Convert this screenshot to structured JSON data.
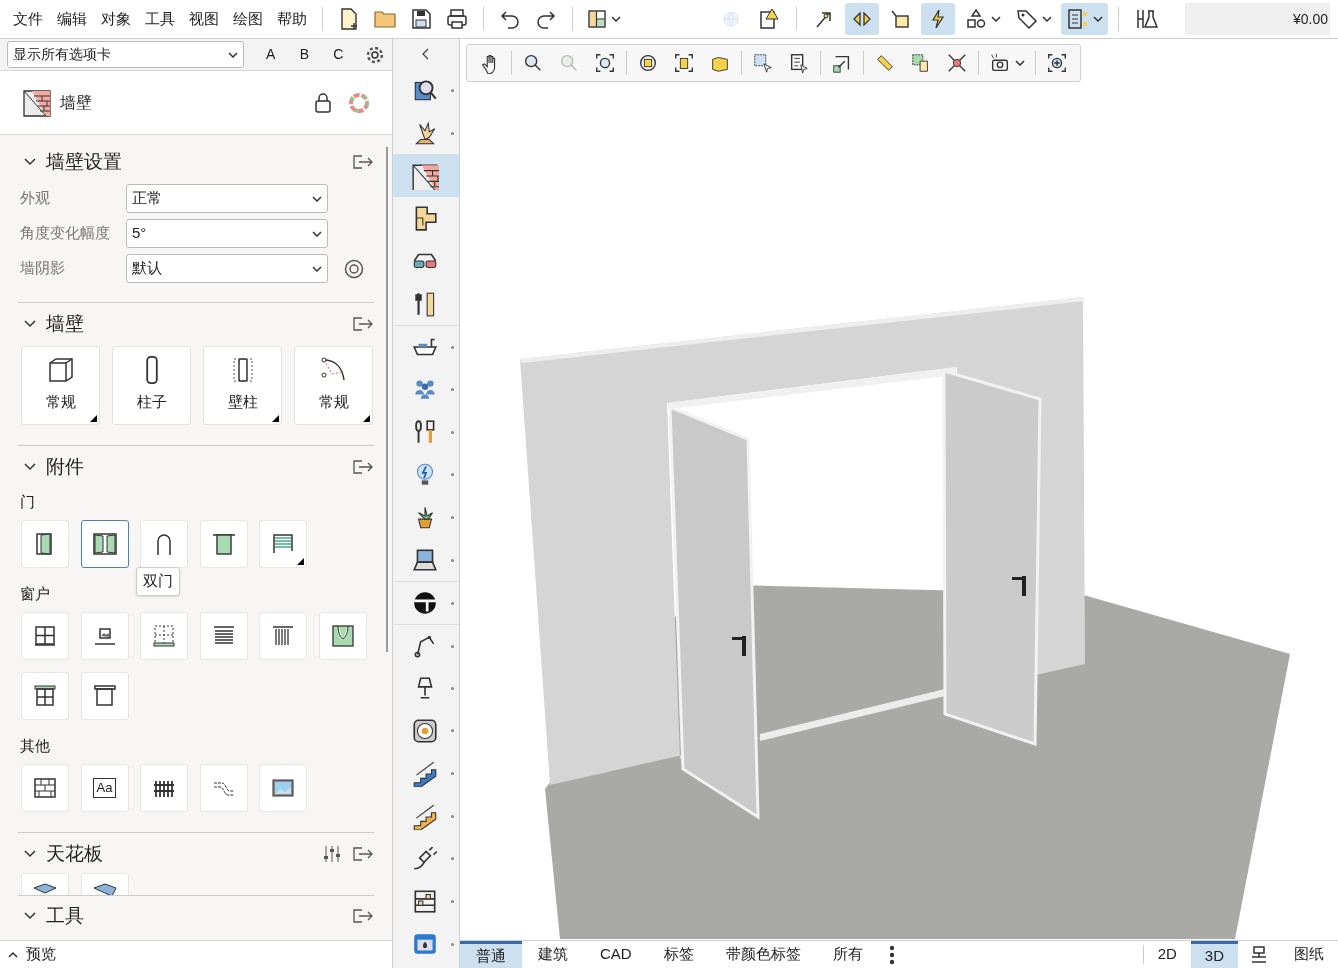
{
  "menu": [
    "文件",
    "编辑",
    "对象",
    "工具",
    "视图",
    "绘图",
    "帮助"
  ],
  "toggles": [
    {
      "selected": false,
      "disabled": true
    },
    {
      "selected": false,
      "disabled": false
    },
    {
      "selected": false,
      "disabled": false
    },
    {
      "selected": true,
      "disabled": false
    },
    {
      "selected": false,
      "disabled": false
    },
    {
      "selected": true,
      "disabled": false
    },
    {
      "selected": false,
      "disabled": false
    },
    {
      "selected": false,
      "disabled": false
    },
    {
      "selected": true,
      "disabled": false
    },
    {
      "selected": false,
      "disabled": false
    }
  ],
  "price": "¥0.00",
  "tab_filter": {
    "value": "显示所有选项卡"
  },
  "letters": [
    "A",
    "B",
    "C"
  ],
  "panel": {
    "title": "墙壁"
  },
  "wall_settings": {
    "title": "墙壁设置",
    "fields": [
      {
        "label": "外观",
        "value": "正常"
      },
      {
        "label": "角度变化幅度",
        "value": "5°"
      },
      {
        "label": "墙阴影",
        "value": "默认"
      }
    ]
  },
  "walls": {
    "title": "墙壁",
    "tools": [
      {
        "label": "常规",
        "more": true
      },
      {
        "label": "柱子",
        "more": false
      },
      {
        "label": "壁柱",
        "more": true
      },
      {
        "label": "常规",
        "more": true
      }
    ]
  },
  "accessories": {
    "title": "附件",
    "groups": [
      {
        "title": "门",
        "items": [
          {
            "selected": false,
            "more": false
          },
          {
            "selected": true,
            "more": false
          },
          {
            "selected": false,
            "more": false
          },
          {
            "selected": false,
            "more": false
          },
          {
            "selected": false,
            "more": true
          }
        ]
      },
      {
        "title": "窗户",
        "items": [
          {
            "selected": false,
            "more": false
          },
          {
            "selected": false,
            "more": false
          },
          {
            "selected": false,
            "more": false
          },
          {
            "selected": false,
            "more": false
          },
          {
            "selected": false,
            "more": false
          },
          {
            "selected": false,
            "more": false
          },
          {
            "selected": false,
            "more": false
          },
          {
            "selected": false,
            "more": false
          }
        ]
      },
      {
        "title": "其他",
        "items": [
          {
            "selected": false,
            "more": false
          },
          {
            "selected": false,
            "more": false,
            "label": "Aa"
          },
          {
            "selected": false,
            "more": false
          },
          {
            "selected": false,
            "more": false
          },
          {
            "selected": false,
            "more": false
          }
        ]
      }
    ]
  },
  "tooltip": "双门",
  "ceiling": {
    "title": "天花板"
  },
  "tools_section": {
    "title": "工具"
  },
  "preview": {
    "label": "预览"
  },
  "categories": [
    {
      "selected": false,
      "more": true
    },
    {
      "selected": false,
      "more": true
    },
    {
      "selected": true,
      "more": false
    },
    {
      "selected": false,
      "more": false
    },
    {
      "selected": false,
      "more": false
    },
    {
      "selected": false,
      "more": false
    },
    {
      "selected": false,
      "more": true
    },
    {
      "selected": false,
      "more": true
    },
    {
      "selected": false,
      "more": true
    },
    {
      "selected": false,
      "more": true
    },
    {
      "selected": false,
      "more": true
    },
    {
      "selected": false,
      "more": true
    },
    {
      "selected": false,
      "more": true
    },
    {
      "selected": false,
      "more": true
    },
    {
      "selected": false,
      "more": true
    },
    {
      "selected": false,
      "more": true
    },
    {
      "selected": false,
      "more": true
    },
    {
      "selected": false,
      "more": true
    },
    {
      "selected": false,
      "more": true
    },
    {
      "selected": false,
      "more": true
    },
    {
      "selected": false,
      "more": true
    }
  ],
  "bottom_tabs": [
    {
      "label": "普通",
      "selected": true
    },
    {
      "label": "建筑",
      "selected": false
    },
    {
      "label": "CAD",
      "selected": false
    },
    {
      "label": "标签",
      "selected": false
    },
    {
      "label": "带颜色标签",
      "selected": false
    },
    {
      "label": "所有",
      "selected": false
    }
  ],
  "view_tabs": [
    {
      "label": "2D",
      "selected": false
    },
    {
      "label": "3D",
      "selected": true
    },
    {
      "label": "图纸",
      "selected": false
    }
  ]
}
